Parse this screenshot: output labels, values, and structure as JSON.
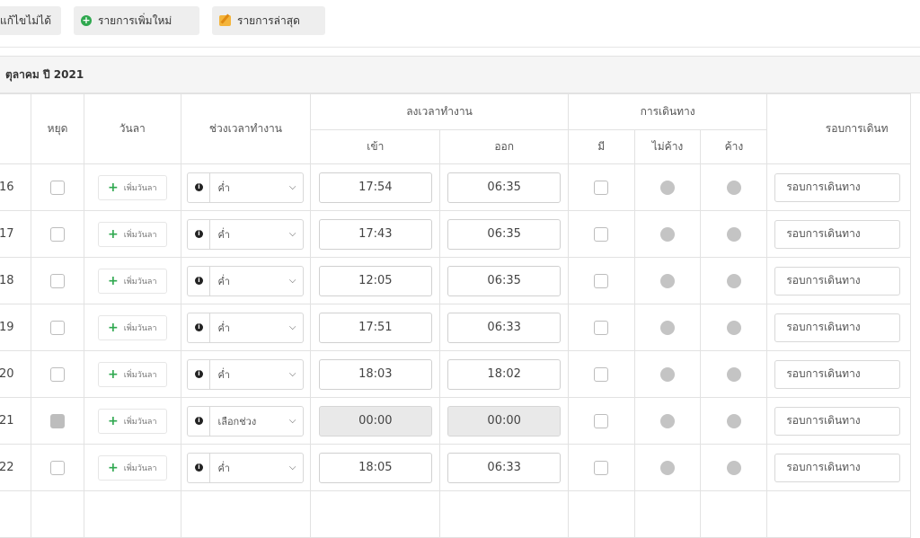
{
  "toolbar": {
    "btn_locked": "แก้ไขไม่ได้",
    "btn_new": "รายการเพิ่มใหม่",
    "btn_latest": "รายการล่าสุด",
    "icons": {
      "new": "plus-circle-icon",
      "latest": "edit-icon"
    }
  },
  "month_heading": "ตุลาคม ปี 2021",
  "table": {
    "headers": {
      "holiday": "หยุด",
      "leave": "วันลา",
      "shift": "ช่วงเวลาทำงาน",
      "clock": "ลงเวลาทำงาน",
      "clock_in": "เข้า",
      "clock_out": "ออก",
      "travel": "การเดินทาง",
      "travel_yes": "มี",
      "travel_no_overnight": "ไม่ค้าง",
      "travel_overnight": "ค้าง",
      "round": "รอบการเดินท"
    },
    "rows": [
      {
        "day": "16",
        "holiday_checked": false,
        "leave_label": "เพิ่มวันลา",
        "shift": "ค่ำ",
        "in": "17:54",
        "out": "06:35",
        "disabled": false,
        "round": "รอบการเดินทาง"
      },
      {
        "day": "17",
        "holiday_checked": false,
        "leave_label": "เพิ่มวันลา",
        "shift": "ค่ำ",
        "in": "17:43",
        "out": "06:35",
        "disabled": false,
        "round": "รอบการเดินทาง"
      },
      {
        "day": "18",
        "holiday_checked": false,
        "leave_label": "เพิ่มวันลา",
        "shift": "ค่ำ",
        "in": "12:05",
        "out": "06:35",
        "disabled": false,
        "round": "รอบการเดินทาง"
      },
      {
        "day": "19",
        "holiday_checked": false,
        "leave_label": "เพิ่มวันลา",
        "shift": "ค่ำ",
        "in": "17:51",
        "out": "06:33",
        "disabled": false,
        "round": "รอบการเดินทาง"
      },
      {
        "day": "20",
        "holiday_checked": false,
        "leave_label": "เพิ่มวันลา",
        "shift": "ค่ำ",
        "in": "18:03",
        "out": "18:02",
        "disabled": false,
        "round": "รอบการเดินทาง"
      },
      {
        "day": "21",
        "holiday_checked": true,
        "leave_label": "เพิ่มวันลา",
        "shift": "เลือกช่วง",
        "in": "00:00",
        "out": "00:00",
        "disabled": true,
        "round": "รอบการเดินทาง"
      },
      {
        "day": "22",
        "holiday_checked": false,
        "leave_label": "เพิ่มวันลา",
        "shift": "ค่ำ",
        "in": "18:05",
        "out": "06:33",
        "disabled": false,
        "round": "รอบการเดินทาง"
      }
    ]
  }
}
